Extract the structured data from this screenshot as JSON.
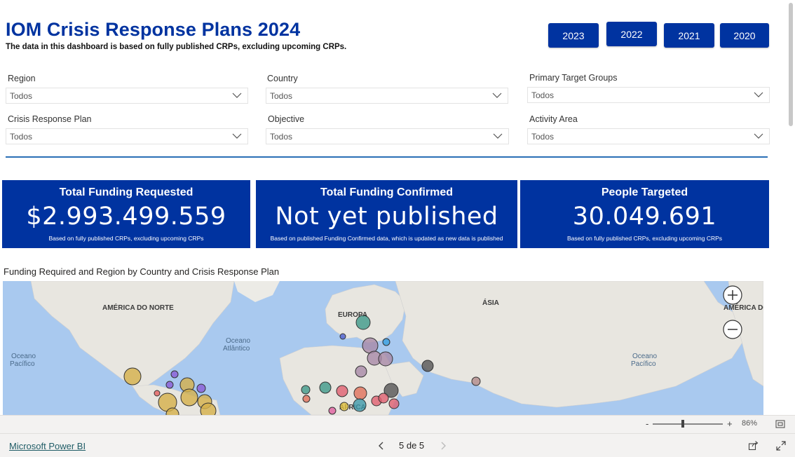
{
  "header": {
    "title": "IOM Crisis Response Plans 2024",
    "subtitle": "The data in this dashboard is based on fully published CRPs, excluding upcoming CRPs."
  },
  "year_buttons": [
    "2023",
    "2022",
    "2021",
    "2020"
  ],
  "filters": [
    {
      "label": "Region",
      "value": "Todos"
    },
    {
      "label": "Country",
      "value": "Todos"
    },
    {
      "label": "Primary Target Groups",
      "value": "Todos"
    },
    {
      "label": "Crisis Response Plan",
      "value": "Todos"
    },
    {
      "label": "Objective",
      "value": "Todos"
    },
    {
      "label": "Activity Area",
      "value": "Todos"
    }
  ],
  "cards": [
    {
      "title": "Total Funding Requested",
      "value": "$2.993.499.559",
      "note": "Based on fully published CRPs, excluding upcoming CRPs"
    },
    {
      "title": "Total Funding Confirmed",
      "value": "Not yet published",
      "note": "Based on published Funding Confirmed data, which is updated as new data is published"
    },
    {
      "title": "People Targeted",
      "value": "30.049.691",
      "note": "Based on fully published CRPs, excluding upcoming CRPs"
    }
  ],
  "map": {
    "title": "Funding Required and Region by Country and Crisis Response Plan",
    "labels": {
      "north_america": "AMÉRICA DO NORTE",
      "europe": "EUROPA",
      "asia": "ÁSIA",
      "north_america_right": "AMÉRICA DO",
      "africa": "ÁFRICA",
      "ocean_pacific_left": "Oceano\nPacífico",
      "ocean_atlantic": "Oceano\nAtlântico",
      "ocean_pacific_right": "Oceano\nPacífico"
    }
  },
  "zoom": {
    "level": "86%",
    "minus": "-",
    "plus": "+"
  },
  "footer": {
    "link": "Microsoft Power BI",
    "page": "5 de 5"
  },
  "colors": {
    "brand": "#0033a0",
    "accent_line": "#2a6fb6"
  },
  "icons": [
    "chevron-down-icon",
    "zoom-in-icon",
    "zoom-out-icon",
    "fit-page-icon",
    "prev-page-icon",
    "next-page-icon",
    "share-icon",
    "fullscreen-icon"
  ]
}
